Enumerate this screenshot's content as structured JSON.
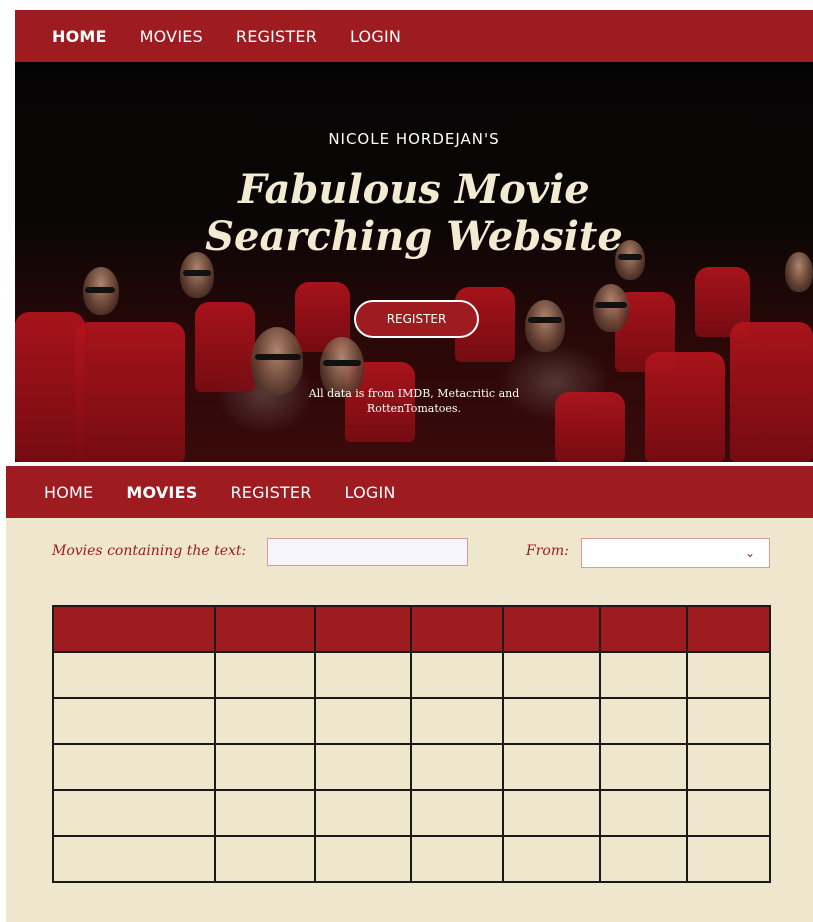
{
  "home_page": {
    "nav": {
      "items": [
        {
          "label": "HOME",
          "active": true
        },
        {
          "label": "MOVIES",
          "active": false
        },
        {
          "label": "REGISTER",
          "active": false
        },
        {
          "label": "LOGIN",
          "active": false
        }
      ]
    },
    "hero": {
      "subtitle": "NICOLE HORDEJAN'S",
      "headline_line1": "Fabulous Movie",
      "headline_line2": "Searching Website",
      "register_button": "REGISTER",
      "note_line1": "All data is from IMDB, Metacritic and",
      "note_line2": "RottenTomatoes."
    }
  },
  "movies_page": {
    "nav": {
      "items": [
        {
          "label": "HOME",
          "active": false
        },
        {
          "label": "MOVIES",
          "active": true
        },
        {
          "label": "REGISTER",
          "active": false
        },
        {
          "label": "LOGIN",
          "active": false
        }
      ]
    },
    "search": {
      "text_label": "Movies containing the text:",
      "text_value": "",
      "from_label": "From:",
      "from_selected": ""
    },
    "table": {
      "headers": [
        "",
        "",
        "",
        "",
        "",
        "",
        ""
      ],
      "rows": [
        [
          "",
          "",
          "",
          "",
          "",
          "",
          ""
        ],
        [
          "",
          "",
          "",
          "",
          "",
          "",
          ""
        ],
        [
          "",
          "",
          "",
          "",
          "",
          "",
          ""
        ],
        [
          "",
          "",
          "",
          "",
          "",
          "",
          ""
        ],
        [
          "",
          "",
          "",
          "",
          "",
          "",
          ""
        ]
      ]
    }
  },
  "colors": {
    "brand_red": "#9e1c20",
    "cream": "#efe7cd",
    "headline_cream": "#f3ead2"
  },
  "icons": {
    "select_chevron": "chevron-down-icon"
  }
}
